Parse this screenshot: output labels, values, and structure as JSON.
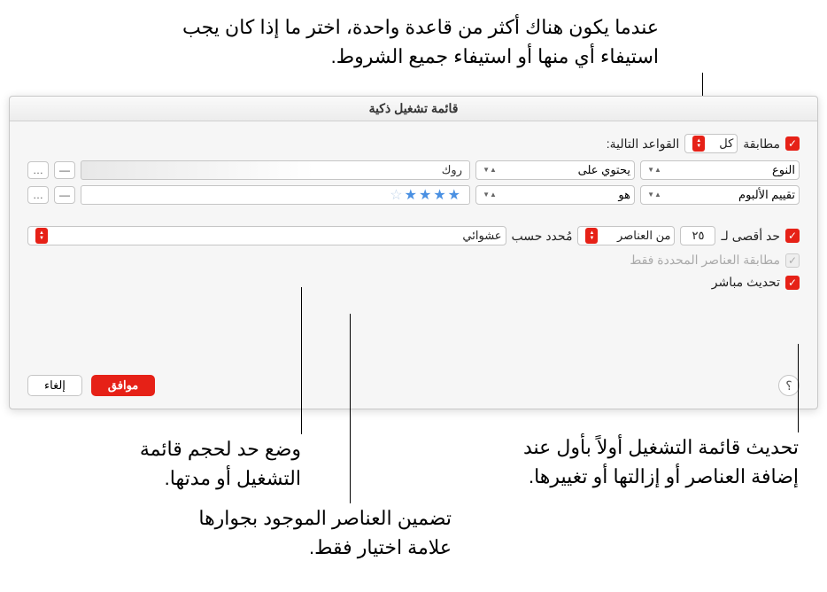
{
  "annotations": {
    "top": "عندما يكون هناك أكثر من قاعدة واحدة، اختر ما إذا كان يجب استيفاء أي منها أو استيفاء جميع الشروط.",
    "limit": "وضع حد لحجم قائمة التشغيل أو مدتها.",
    "checked_only": "تضمين العناصر الموجود بجوارها علامة اختيار فقط.",
    "live_update": "تحديث قائمة التشغيل أولاً بأول عند إضافة العناصر أو إزالتها أو تغييرها."
  },
  "dialog": {
    "title": "قائمة تشغيل ذكية",
    "match_label": "مطابقة",
    "match_scope": "كل",
    "match_suffix": "القواعد التالية:",
    "rules": [
      {
        "field": "النوع",
        "op": "يحتوي على",
        "value": "روك"
      },
      {
        "field": "تقييم الألبوم",
        "op": "هو",
        "value_stars": 4
      }
    ],
    "limit": {
      "label": "حد أقصى لـ",
      "count": "٢٥",
      "unit": "من العناصر",
      "selected_by_label": "مُحدد حسب",
      "selected_by_value": "عشوائي"
    },
    "match_checked_only": "مطابقة العناصر المحددة فقط",
    "live_update": "تحديث مباشر",
    "ok": "موافق",
    "cancel": "إلغاء",
    "help": "؟",
    "minus": "—",
    "dots": "…"
  }
}
